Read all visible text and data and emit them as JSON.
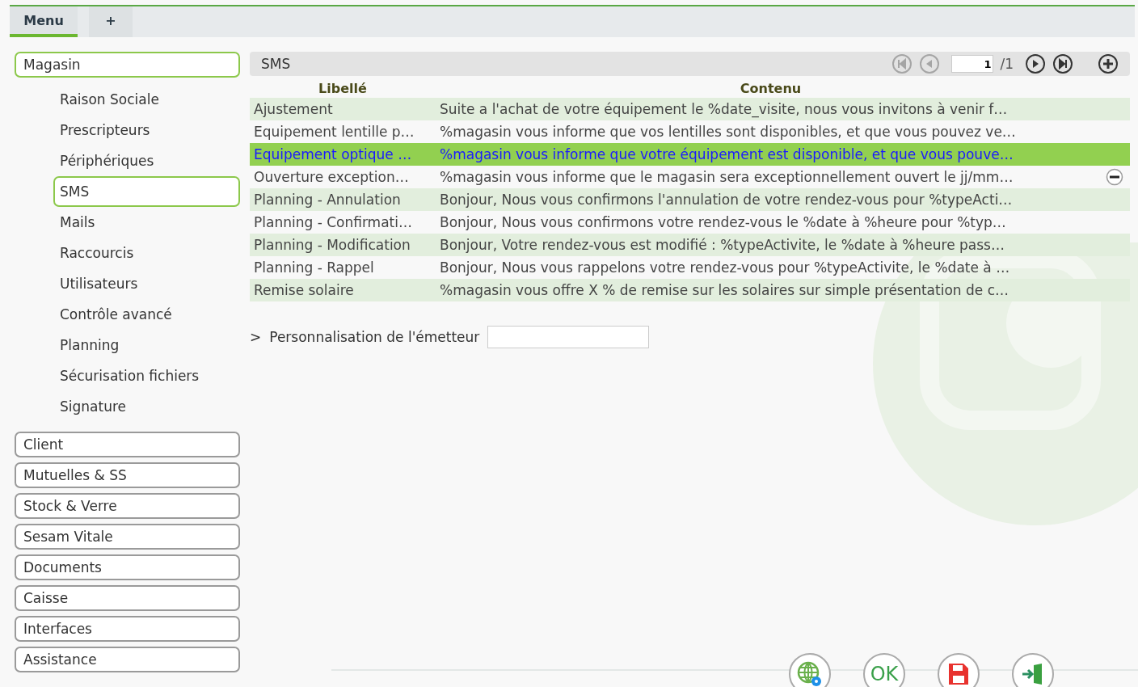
{
  "tabs": [
    {
      "label": "Menu",
      "selected": true
    },
    {
      "label": "+",
      "selected": false
    }
  ],
  "sidebar": {
    "groups": [
      {
        "label": "Magasin",
        "selected": true,
        "children": [
          {
            "label": "Raison Sociale",
            "selected": false
          },
          {
            "label": "Prescripteurs",
            "selected": false
          },
          {
            "label": "Périphériques",
            "selected": false
          },
          {
            "label": "SMS",
            "selected": true
          },
          {
            "label": "Mails",
            "selected": false
          },
          {
            "label": "Raccourcis",
            "selected": false
          },
          {
            "label": "Utilisateurs",
            "selected": false
          },
          {
            "label": "Contrôle avancé",
            "selected": false
          },
          {
            "label": "Planning",
            "selected": false
          },
          {
            "label": "Sécurisation fichiers",
            "selected": false
          },
          {
            "label": "Signature",
            "selected": false
          }
        ]
      },
      {
        "label": "Client",
        "selected": false
      },
      {
        "label": "Mutuelles & SS",
        "selected": false
      },
      {
        "label": "Stock & Verre",
        "selected": false
      },
      {
        "label": "Sesam Vitale",
        "selected": false
      },
      {
        "label": "Documents",
        "selected": false
      },
      {
        "label": "Caisse",
        "selected": false
      },
      {
        "label": "Interfaces",
        "selected": false
      },
      {
        "label": "Assistance",
        "selected": false
      }
    ]
  },
  "panel": {
    "title": "SMS",
    "pager": {
      "page": "1",
      "total": "/1",
      "first_disabled": true,
      "prev_disabled": true,
      "next_disabled": false,
      "last_disabled": false
    }
  },
  "table": {
    "columns": [
      "Libellé",
      "Contenu"
    ],
    "rows": [
      {
        "label": "Ajustement",
        "content": "Suite a l'achat de votre équipement le %date_visite, nous vous invitons à venir f…",
        "selected": false,
        "hovered": false
      },
      {
        "label": "Equipement lentille p…",
        "content": "%magasin vous informe que vos lentilles sont disponibles, et que vous pouvez ve…",
        "selected": false,
        "hovered": false
      },
      {
        "label": "Equipement optique …",
        "content": "%magasin vous informe que votre équipement est disponible, et que vous pouve…",
        "selected": true,
        "hovered": false
      },
      {
        "label": "Ouverture exception…",
        "content": "%magasin vous informe que le magasin sera exceptionnellement ouvert le jj/mm…",
        "selected": false,
        "hovered": true
      },
      {
        "label": "Planning - Annulation",
        "content": "Bonjour, Nous vous confirmons l'annulation de votre rendez-vous pour %typeActi…",
        "selected": false,
        "hovered": false
      },
      {
        "label": "Planning - Confirmati…",
        "content": "Bonjour, Nous vous confirmons votre rendez-vous le %date à %heure pour %typ…",
        "selected": false,
        "hovered": false
      },
      {
        "label": "Planning - Modification",
        "content": "Bonjour, Votre rendez-vous est modifié : %typeActivite, le %date à %heure pass…",
        "selected": false,
        "hovered": false
      },
      {
        "label": "Planning - Rappel",
        "content": "Bonjour, Nous vous rappelons votre rendez-vous pour %typeActivite, le %date à …",
        "selected": false,
        "hovered": false
      },
      {
        "label": "Remise solaire",
        "content": "%magasin vous offre X % de remise sur les solaires sur simple présentation de c…",
        "selected": false,
        "hovered": false
      }
    ]
  },
  "sender": {
    "marker": ">",
    "label": "Personnalisation de l'émetteur"
  },
  "footer": {
    "buttons": [
      {
        "kind": "web"
      },
      {
        "kind": "ok",
        "label": "OK"
      },
      {
        "kind": "save"
      },
      {
        "kind": "exit"
      }
    ]
  }
}
